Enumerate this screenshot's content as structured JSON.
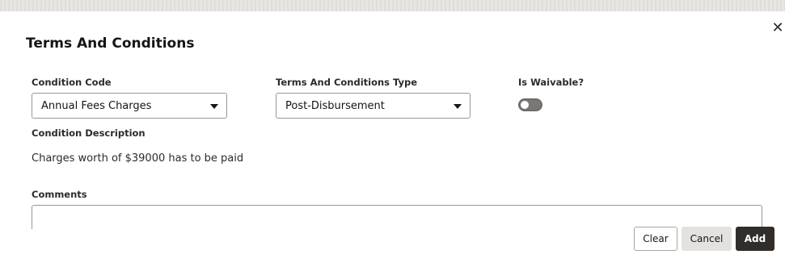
{
  "dialog": {
    "title": "Terms And Conditions",
    "close_icon": "close-icon"
  },
  "form": {
    "condition_code": {
      "label": "Condition Code",
      "value": "Annual Fees Charges"
    },
    "terms_type": {
      "label": "Terms And Conditions Type",
      "value": "Post-Disbursement"
    },
    "is_waivable": {
      "label": "Is Waivable?",
      "checked": false
    },
    "condition_description": {
      "label": "Condition Description",
      "value": "Charges worth of $39000 has to be paid"
    },
    "comments": {
      "label": "Comments",
      "value": ""
    }
  },
  "actions": {
    "clear_label": "Clear",
    "cancel_label": "Cancel",
    "add_label": "Add"
  },
  "colors": {
    "primary_button": "#312d2a",
    "secondary_button": "#e4e2df",
    "toggle_off": "#7a7874"
  }
}
